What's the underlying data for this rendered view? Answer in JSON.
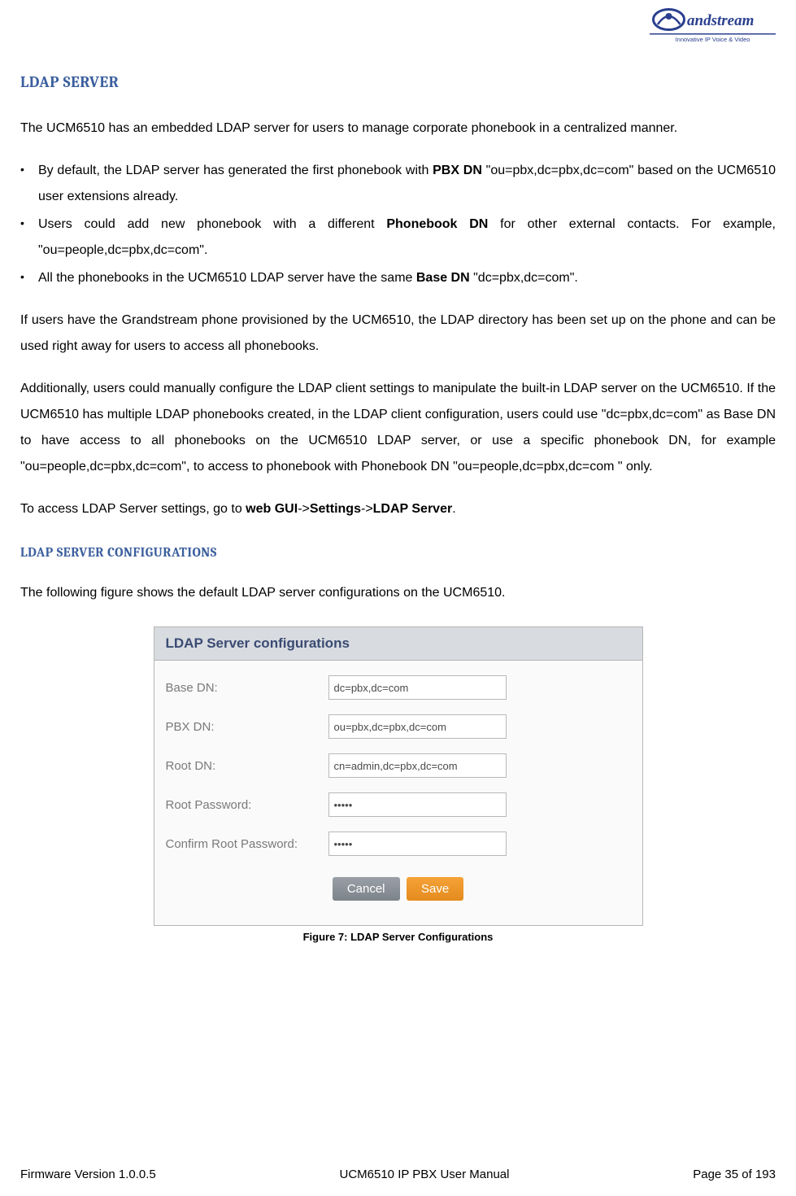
{
  "logo": {
    "brand": "Grandstream",
    "tagline": "Innovative IP Voice & Video"
  },
  "heading_ldap_server": "LDAP SERVER",
  "intro_para": "The UCM6510 has an embedded LDAP server for users to manage corporate phonebook in a centralized manner.",
  "bullets": [
    {
      "pre": "By default, the LDAP server has generated the first phonebook with ",
      "bold": "PBX DN",
      "mid": " \"ou=pbx,dc=pbx,dc=com\" based on the UCM6510 user extensions already."
    },
    {
      "pre": "Users could add new phonebook with a different ",
      "bold": "Phonebook DN",
      "mid": " for other external contacts. For example, \"ou=people,dc=pbx,dc=com\"."
    },
    {
      "pre": "All the phonebooks in the UCM6510 LDAP server have the same ",
      "bold": "Base DN",
      "mid": " \"dc=pbx,dc=com\"."
    }
  ],
  "para_provisioned": "If users have the Grandstream phone provisioned by the UCM6510, the LDAP directory has been set up on the phone and can be used right away for users to access all phonebooks.",
  "para_additionally": "Additionally, users could manually configure the LDAP client settings to manipulate the built-in LDAP server on the UCM6510. If the UCM6510 has multiple LDAP phonebooks created, in the LDAP client configuration, users could use \"dc=pbx,dc=com\" as Base DN to have access to all phonebooks on the UCM6510 LDAP server, or use a specific phonebook DN, for example \"ou=people,dc=pbx,dc=com\", to access to phonebook with Phonebook DN \"ou=people,dc=pbx,dc=com \" only.",
  "nav_path": {
    "prefix": "To access LDAP Server settings, go to ",
    "p1": "web GUI",
    "arrow1": "->",
    "p2": "Settings",
    "arrow2": "->",
    "p3": "LDAP Server",
    "suffix": "."
  },
  "heading_configurations": "LDAP SERVER CONFIGURATIONS",
  "para_following": "The following figure shows the default LDAP server configurations on the UCM6510.",
  "config": {
    "title": "LDAP Server configurations",
    "rows": [
      {
        "label": "Base DN:",
        "value": "dc=pbx,dc=com",
        "type": "text"
      },
      {
        "label": "PBX DN:",
        "value": "ou=pbx,dc=pbx,dc=com",
        "type": "text"
      },
      {
        "label": "Root DN:",
        "value": "cn=admin,dc=pbx,dc=com",
        "type": "text"
      },
      {
        "label": "Root Password:",
        "value": "•••••",
        "type": "password"
      },
      {
        "label": "Confirm Root Password:",
        "value": "•••••",
        "type": "password"
      }
    ],
    "cancel": "Cancel",
    "save": "Save"
  },
  "figure_caption": "Figure 7: LDAP Server Configurations",
  "footer": {
    "left": "Firmware Version 1.0.0.5",
    "center": "UCM6510 IP PBX User Manual",
    "right": "Page 35 of 193"
  }
}
